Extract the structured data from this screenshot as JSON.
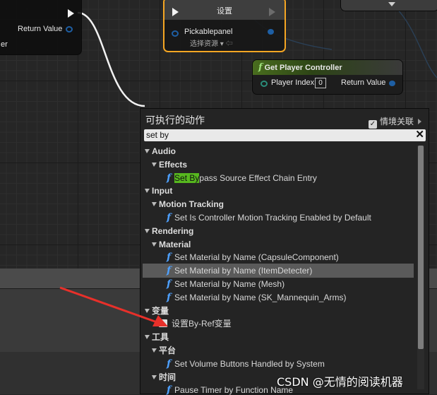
{
  "nodes": {
    "return_node": {
      "return_label": "Return Value",
      "partial_label": "er"
    },
    "set_node": {
      "title": "设置",
      "pin_label": "Pickablepanel",
      "dropdown_label": "选择资源"
    },
    "gpc_node": {
      "title": "Get Player Controller",
      "player_index_label": "Player Index",
      "player_index_value": "0",
      "return_label": "Return Value"
    }
  },
  "menu": {
    "title": "可执行的动作",
    "context_label": "情境关联",
    "context_checked": true,
    "search_value": "set by",
    "rows": [
      {
        "kind": "category",
        "label": "Audio"
      },
      {
        "kind": "subcategory",
        "label": "Effects"
      },
      {
        "kind": "function",
        "highlight": "Set By",
        "rest": "pass Source Effect Chain Entry"
      },
      {
        "kind": "category",
        "label": "Input"
      },
      {
        "kind": "subcategory",
        "label": "Motion Tracking"
      },
      {
        "kind": "function",
        "label": "Set Is Controller Motion Tracking Enabled by Default"
      },
      {
        "kind": "category",
        "label": "Rendering"
      },
      {
        "kind": "subcategory",
        "label": "Material"
      },
      {
        "kind": "function",
        "label": "Set Material by Name (CapsuleComponent)"
      },
      {
        "kind": "function",
        "label": "Set Material by Name (ItemDetecter)",
        "selected": true
      },
      {
        "kind": "function",
        "label": "Set Material by Name (Mesh)"
      },
      {
        "kind": "function",
        "label": "Set Material by Name (SK_Mannequin_Arms)"
      },
      {
        "kind": "category",
        "label": "变量"
      },
      {
        "kind": "variable",
        "label": "设置By-Ref变量"
      },
      {
        "kind": "category",
        "label": "工具"
      },
      {
        "kind": "subcategory",
        "label": "平台"
      },
      {
        "kind": "function",
        "label": "Set Volume Buttons Handled by System"
      },
      {
        "kind": "subcategory",
        "label": "时间"
      },
      {
        "kind": "function",
        "label": "Pause Timer by Function Name"
      }
    ]
  },
  "watermark": "CSDN @无情的阅读机器",
  "colors": {
    "accent_selected_node": "#f5a623",
    "search_highlight": "#57b81f",
    "function_icon": "#4ea1ff",
    "pin_blue": "#1e5fa4"
  },
  "icons": {
    "function": "function-f-icon",
    "exec": "exec-pin-icon",
    "checkbox": "checkbox-icon",
    "clear": "close-icon"
  }
}
